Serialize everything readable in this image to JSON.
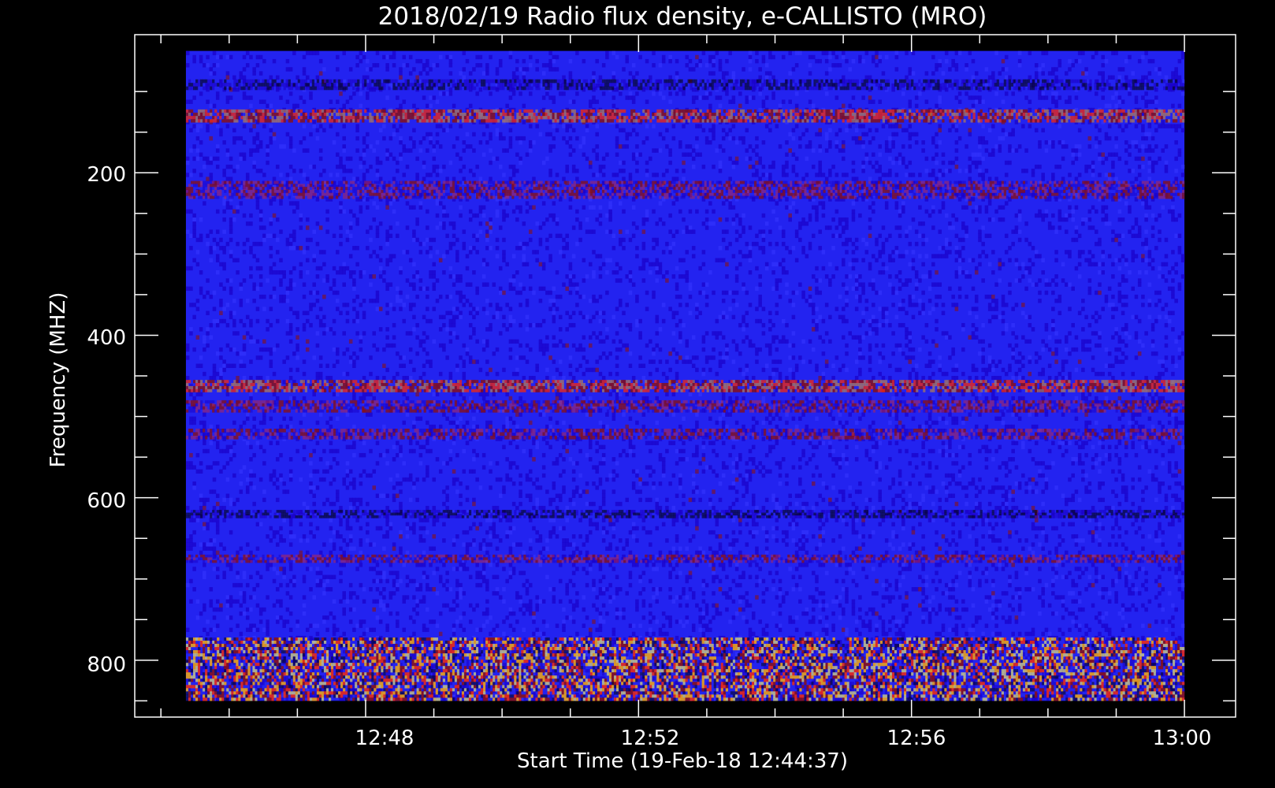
{
  "chart_data": {
    "type": "heatmap",
    "title": "2018/02/19  Radio flux density, e-CALLISTO (MRO)",
    "xlabel": "Start Time (19-Feb-18 12:44:37)",
    "ylabel": "Frequency (MHZ)",
    "x_start": "12:45:22",
    "x_end": "13:00:00",
    "xlim": [
      "12:44:37",
      "13:00:45"
    ],
    "x_ticks": [
      "12:48",
      "12:52",
      "12:56",
      "13:00"
    ],
    "y_ticks": [
      200,
      400,
      600,
      800
    ],
    "ylim": [
      30,
      870
    ],
    "y_data_range": [
      50,
      850
    ],
    "y_inverted": true,
    "grid": false,
    "legend": "none",
    "colorscale": [
      "#000000",
      "#1a00c8",
      "#2323f0",
      "#8b1010",
      "#ff2a00",
      "#ffb000",
      "#ffff60"
    ],
    "bright_bands_mhz": [
      {
        "from": 85,
        "to": 98,
        "level": "dark"
      },
      {
        "from": 122,
        "to": 138,
        "level": "high"
      },
      {
        "from": 210,
        "to": 232,
        "level": "medium"
      },
      {
        "from": 455,
        "to": 470,
        "level": "high"
      },
      {
        "from": 480,
        "to": 495,
        "level": "medium"
      },
      {
        "from": 515,
        "to": 528,
        "level": "medium"
      },
      {
        "from": 615,
        "to": 625,
        "level": "dark"
      },
      {
        "from": 670,
        "to": 680,
        "level": "medium"
      },
      {
        "from": 772,
        "to": 850,
        "level": "very-high"
      }
    ]
  }
}
